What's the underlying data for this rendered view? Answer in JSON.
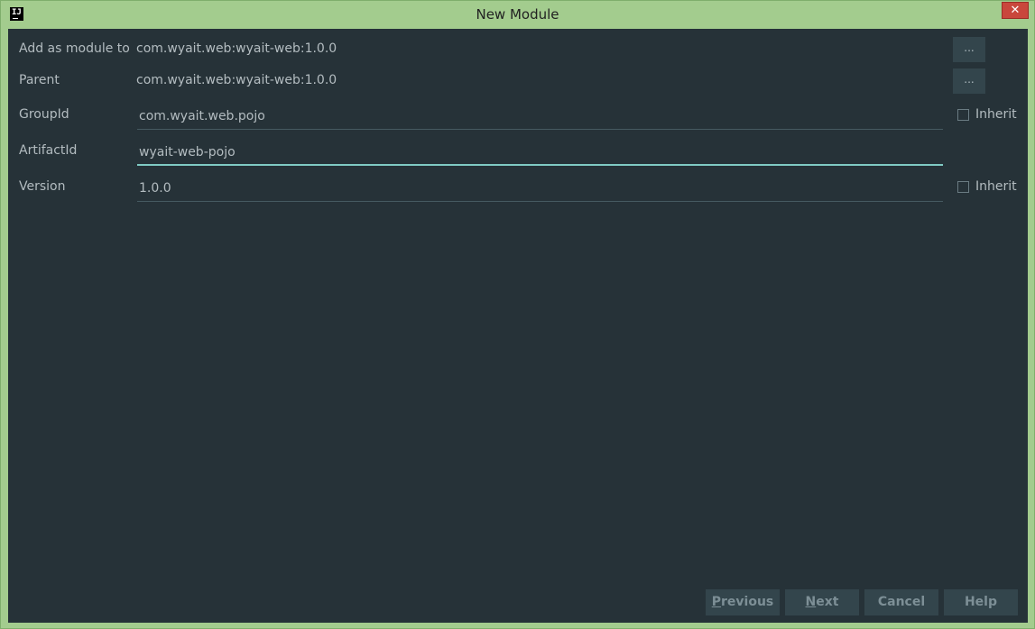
{
  "window": {
    "title": "New Module",
    "app_icon_text": "IJ",
    "close_glyph": "✕"
  },
  "form": {
    "add_as_module_to": {
      "label": "Add as module to",
      "value": "com.wyait.web:wyait-web:1.0.0",
      "browse_label": "..."
    },
    "parent": {
      "label": "Parent",
      "value": "com.wyait.web:wyait-web:1.0.0",
      "browse_label": "..."
    },
    "group_id": {
      "label": "GroupId",
      "value": "com.wyait.web.pojo",
      "inherit_label": "Inherit",
      "inherit_checked": false
    },
    "artifact_id": {
      "label": "ArtifactId",
      "value": "wyait-web-pojo",
      "focused": true
    },
    "version": {
      "label": "Version",
      "value": "1.0.0",
      "inherit_label": "Inherit",
      "inherit_checked": false
    }
  },
  "footer": {
    "previous": {
      "mnemonic": "P",
      "rest": "revious"
    },
    "next": {
      "mnemonic": "N",
      "rest": "ext"
    },
    "cancel": "Cancel",
    "help": "Help"
  },
  "colors": {
    "titlebar": "#a3cc8e",
    "content_bg": "#263238",
    "focus_accent": "#80cbc4",
    "close_button": "#c9473c"
  }
}
